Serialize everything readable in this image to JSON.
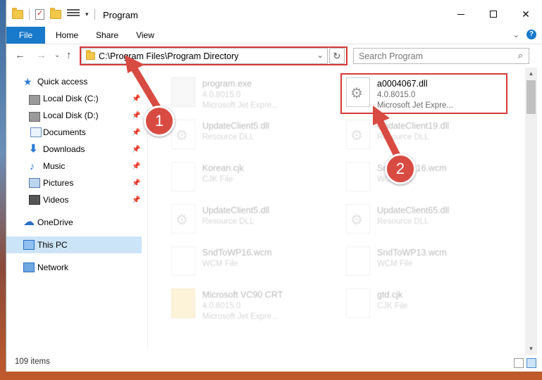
{
  "window": {
    "title": "Program",
    "controls": {
      "minimize": "minimize",
      "maximize": "maximize",
      "close": "✕"
    }
  },
  "ribbon": {
    "tabs": [
      "File",
      "Home",
      "Share",
      "View"
    ],
    "help": "?"
  },
  "address": {
    "path": "C:\\Program Files\\Program Directory",
    "search_placeholder": "Search Program"
  },
  "sidebar": {
    "items": [
      {
        "label": "Quick access",
        "icon": "star-icon"
      },
      {
        "label": "Local Disk (C:)",
        "icon": "disk-icon",
        "pinned": true
      },
      {
        "label": "Local Disk (D:)",
        "icon": "disk-icon",
        "pinned": true
      },
      {
        "label": "Documents",
        "icon": "documents-icon",
        "pinned": true
      },
      {
        "label": "Downloads",
        "icon": "download-icon",
        "pinned": true
      },
      {
        "label": "Music",
        "icon": "music-icon",
        "pinned": true
      },
      {
        "label": "Pictures",
        "icon": "pictures-icon",
        "pinned": true
      },
      {
        "label": "Videos",
        "icon": "videos-icon",
        "pinned": true
      },
      {
        "label": "OneDrive",
        "icon": "cloud-icon"
      },
      {
        "label": "This PC",
        "icon": "pc-icon",
        "selected": true
      },
      {
        "label": "Network",
        "icon": "network-icon"
      }
    ]
  },
  "files": [
    {
      "name": "program.exe",
      "line1": "4.0.8015.0",
      "line2": "Microsoft Jet Expre...",
      "icon": "exe",
      "faded": true
    },
    {
      "name": "a0004067.dll",
      "line1": "4.0.8015.0",
      "line2": "Microsoft Jet Expre...",
      "icon": "gear",
      "faded": false
    },
    {
      "name": "UpdateClient5.dll",
      "line1": "Resource DLL",
      "line2": "",
      "icon": "gear",
      "faded": true
    },
    {
      "name": "UpdateClient19.dll",
      "line1": "Resource DLL",
      "line2": "",
      "icon": "gear",
      "faded": true
    },
    {
      "name": "Korean.cjk",
      "line1": "CJK File",
      "line2": "",
      "icon": "blank",
      "faded": true
    },
    {
      "name": "SndToWP16.wcm",
      "line1": "WCM File",
      "line2": "",
      "icon": "blank",
      "faded": true
    },
    {
      "name": "UpdateClient5.dll",
      "line1": "Resource DLL",
      "line2": "",
      "icon": "gear",
      "faded": true
    },
    {
      "name": "UpdateClient65.dll",
      "line1": "Resource DLL",
      "line2": "",
      "icon": "gear",
      "faded": true
    },
    {
      "name": "SndToWP16.wcm",
      "line1": "WCM File",
      "line2": "",
      "icon": "blank",
      "faded": true
    },
    {
      "name": "SndToWP13.wcm",
      "line1": "WCM File",
      "line2": "",
      "icon": "blank",
      "faded": true
    },
    {
      "name": "Microsoft VC90 CRT",
      "line1": "4.0.8015.0",
      "line2": "Microsoft Jet Expre...",
      "icon": "folder",
      "faded": true
    },
    {
      "name": "gtd.cjk",
      "line1": "CJK File",
      "line2": "",
      "icon": "blank",
      "faded": true
    }
  ],
  "status": {
    "item_count": "109 items"
  },
  "callouts": [
    "1",
    "2"
  ],
  "colors": {
    "accent": "#1979ca",
    "callout": "#d84b42",
    "highlight_border": "#d63a3a",
    "selected_bg": "#cce4f7"
  }
}
